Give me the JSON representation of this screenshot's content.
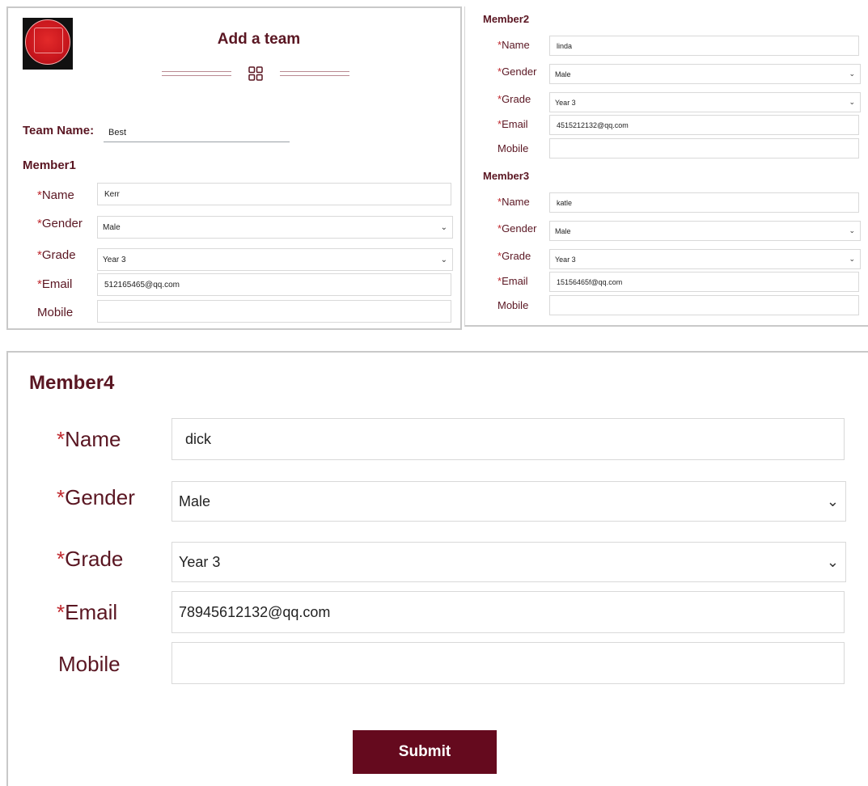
{
  "form": {
    "title": "Add a team",
    "team_name_label": "Team Name:",
    "team_name_value": "Best",
    "submit_label": "Submit"
  },
  "fields": {
    "name": "Name",
    "gender": "Gender",
    "grade": "Grade",
    "email": "Email",
    "mobile": "Mobile",
    "required_mark": "*"
  },
  "members": [
    {
      "heading": "Member1",
      "name": "Kerr",
      "gender": "Male",
      "grade": "Year 3",
      "email": "512165465@qq.com",
      "mobile": ""
    },
    {
      "heading": "Member2",
      "name": "linda",
      "gender": "Male",
      "grade": "Year 3",
      "email": "4515212132@qq.com",
      "mobile": ""
    },
    {
      "heading": "Member3",
      "name": "katle",
      "gender": "Male",
      "grade": "Year 3",
      "email": "15156465f@qq.com",
      "mobile": ""
    },
    {
      "heading": "Member4",
      "name": "dick",
      "gender": "Male",
      "grade": "Year 3",
      "email": "78945612132@qq.com",
      "mobile": ""
    }
  ],
  "icons": {
    "logo": "university-seal-logo",
    "divider": "grid-icon",
    "dropdown": "chevron-down-icon"
  },
  "colors": {
    "accent": "#5a1622",
    "required": "#c0272d",
    "button": "#650a1e"
  }
}
